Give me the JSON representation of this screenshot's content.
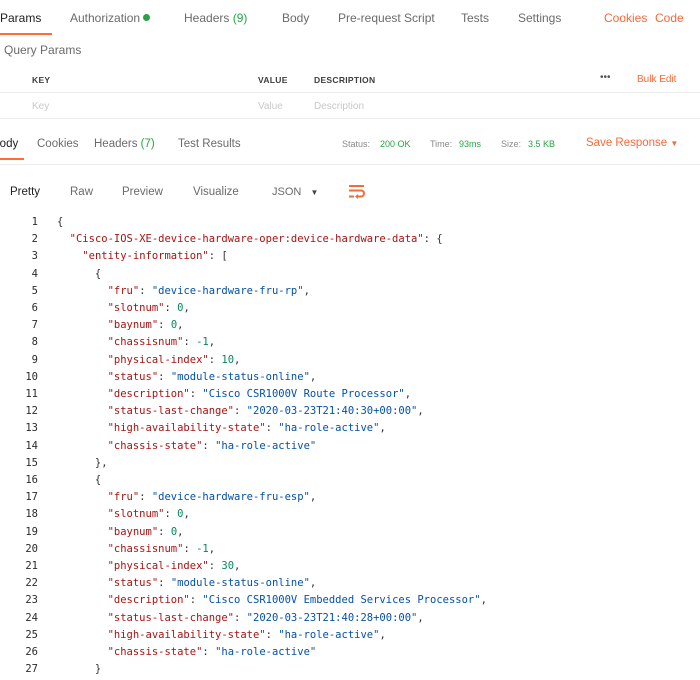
{
  "request_tabs": {
    "params": "Params",
    "authorization": "Authorization",
    "headers": "Headers",
    "headers_count": "(9)",
    "body": "Body",
    "pre_request": "Pre-request Script",
    "tests": "Tests",
    "settings": "Settings",
    "cookies": "Cookies",
    "code": "Code"
  },
  "query_params": {
    "title": "Query Params",
    "col_key": "KEY",
    "col_value": "VALUE",
    "col_description": "DESCRIPTION",
    "more": "•••",
    "bulk_edit": "Bulk Edit",
    "key_placeholder": "Key",
    "value_placeholder": "Value",
    "description_placeholder": "Description"
  },
  "response_tabs": {
    "body": "Body",
    "cookies": "Cookies",
    "headers": "Headers",
    "headers_count": "(7)",
    "test_results": "Test Results"
  },
  "response_meta": {
    "status_label": "Status:",
    "status_value": "200 OK",
    "time_label": "Time:",
    "time_value": "93ms",
    "size_label": "Size:",
    "size_value": "3.5 KB",
    "save_response": "Save Response",
    "save_arrow": "▼"
  },
  "format_toolbar": {
    "pretty": "Pretty",
    "raw": "Raw",
    "preview": "Preview",
    "visualize": "Visualize",
    "language": "JSON",
    "language_arrow": "▼"
  },
  "colors": {
    "accent": "#ff6c37",
    "green": "#27a344",
    "json_key": "#a31515",
    "json_string": "#0451a5",
    "json_number": "#098658"
  },
  "code_lines": [
    {
      "n": "1",
      "parts": [
        [
          "p",
          "{"
        ]
      ]
    },
    {
      "n": "2",
      "parts": [
        [
          "p",
          "  "
        ],
        [
          "k",
          "\"Cisco-IOS-XE-device-hardware-oper:device-hardware-data\""
        ],
        [
          "p",
          ": {"
        ]
      ]
    },
    {
      "n": "3",
      "parts": [
        [
          "p",
          "    "
        ],
        [
          "k",
          "\"entity-information\""
        ],
        [
          "p",
          ": ["
        ]
      ]
    },
    {
      "n": "4",
      "parts": [
        [
          "p",
          "      {"
        ]
      ]
    },
    {
      "n": "5",
      "parts": [
        [
          "p",
          "        "
        ],
        [
          "k",
          "\"fru\""
        ],
        [
          "p",
          ": "
        ],
        [
          "s",
          "\"device-hardware-fru-rp\""
        ],
        [
          "p",
          ","
        ]
      ]
    },
    {
      "n": "6",
      "parts": [
        [
          "p",
          "        "
        ],
        [
          "k",
          "\"slotnum\""
        ],
        [
          "p",
          ": "
        ],
        [
          "n",
          "0"
        ],
        [
          "p",
          ","
        ]
      ]
    },
    {
      "n": "7",
      "parts": [
        [
          "p",
          "        "
        ],
        [
          "k",
          "\"baynum\""
        ],
        [
          "p",
          ": "
        ],
        [
          "n",
          "0"
        ],
        [
          "p",
          ","
        ]
      ]
    },
    {
      "n": "8",
      "parts": [
        [
          "p",
          "        "
        ],
        [
          "k",
          "\"chassisnum\""
        ],
        [
          "p",
          ": "
        ],
        [
          "n",
          "-1"
        ],
        [
          "p",
          ","
        ]
      ]
    },
    {
      "n": "9",
      "parts": [
        [
          "p",
          "        "
        ],
        [
          "k",
          "\"physical-index\""
        ],
        [
          "p",
          ": "
        ],
        [
          "n",
          "10"
        ],
        [
          "p",
          ","
        ]
      ]
    },
    {
      "n": "10",
      "parts": [
        [
          "p",
          "        "
        ],
        [
          "k",
          "\"status\""
        ],
        [
          "p",
          ": "
        ],
        [
          "s",
          "\"module-status-online\""
        ],
        [
          "p",
          ","
        ]
      ]
    },
    {
      "n": "11",
      "parts": [
        [
          "p",
          "        "
        ],
        [
          "k",
          "\"description\""
        ],
        [
          "p",
          ": "
        ],
        [
          "s",
          "\"Cisco CSR1000V Route Processor\""
        ],
        [
          "p",
          ","
        ]
      ]
    },
    {
      "n": "12",
      "parts": [
        [
          "p",
          "        "
        ],
        [
          "k",
          "\"status-last-change\""
        ],
        [
          "p",
          ": "
        ],
        [
          "s",
          "\"2020-03-23T21:40:30+00:00\""
        ],
        [
          "p",
          ","
        ]
      ]
    },
    {
      "n": "13",
      "parts": [
        [
          "p",
          "        "
        ],
        [
          "k",
          "\"high-availability-state\""
        ],
        [
          "p",
          ": "
        ],
        [
          "s",
          "\"ha-role-active\""
        ],
        [
          "p",
          ","
        ]
      ]
    },
    {
      "n": "14",
      "parts": [
        [
          "p",
          "        "
        ],
        [
          "k",
          "\"chassis-state\""
        ],
        [
          "p",
          ": "
        ],
        [
          "s",
          "\"ha-role-active\""
        ]
      ]
    },
    {
      "n": "15",
      "parts": [
        [
          "p",
          "      },"
        ]
      ]
    },
    {
      "n": "16",
      "parts": [
        [
          "p",
          "      {"
        ]
      ]
    },
    {
      "n": "17",
      "parts": [
        [
          "p",
          "        "
        ],
        [
          "k",
          "\"fru\""
        ],
        [
          "p",
          ": "
        ],
        [
          "s",
          "\"device-hardware-fru-esp\""
        ],
        [
          "p",
          ","
        ]
      ]
    },
    {
      "n": "18",
      "parts": [
        [
          "p",
          "        "
        ],
        [
          "k",
          "\"slotnum\""
        ],
        [
          "p",
          ": "
        ],
        [
          "n",
          "0"
        ],
        [
          "p",
          ","
        ]
      ]
    },
    {
      "n": "19",
      "parts": [
        [
          "p",
          "        "
        ],
        [
          "k",
          "\"baynum\""
        ],
        [
          "p",
          ": "
        ],
        [
          "n",
          "0"
        ],
        [
          "p",
          ","
        ]
      ]
    },
    {
      "n": "20",
      "parts": [
        [
          "p",
          "        "
        ],
        [
          "k",
          "\"chassisnum\""
        ],
        [
          "p",
          ": "
        ],
        [
          "n",
          "-1"
        ],
        [
          "p",
          ","
        ]
      ]
    },
    {
      "n": "21",
      "parts": [
        [
          "p",
          "        "
        ],
        [
          "k",
          "\"physical-index\""
        ],
        [
          "p",
          ": "
        ],
        [
          "n",
          "30"
        ],
        [
          "p",
          ","
        ]
      ]
    },
    {
      "n": "22",
      "parts": [
        [
          "p",
          "        "
        ],
        [
          "k",
          "\"status\""
        ],
        [
          "p",
          ": "
        ],
        [
          "s",
          "\"module-status-online\""
        ],
        [
          "p",
          ","
        ]
      ]
    },
    {
      "n": "23",
      "parts": [
        [
          "p",
          "        "
        ],
        [
          "k",
          "\"description\""
        ],
        [
          "p",
          ": "
        ],
        [
          "s",
          "\"Cisco CSR1000V Embedded Services Processor\""
        ],
        [
          "p",
          ","
        ]
      ]
    },
    {
      "n": "24",
      "parts": [
        [
          "p",
          "        "
        ],
        [
          "k",
          "\"status-last-change\""
        ],
        [
          "p",
          ": "
        ],
        [
          "s",
          "\"2020-03-23T21:40:28+00:00\""
        ],
        [
          "p",
          ","
        ]
      ]
    },
    {
      "n": "25",
      "parts": [
        [
          "p",
          "        "
        ],
        [
          "k",
          "\"high-availability-state\""
        ],
        [
          "p",
          ": "
        ],
        [
          "s",
          "\"ha-role-active\""
        ],
        [
          "p",
          ","
        ]
      ]
    },
    {
      "n": "26",
      "parts": [
        [
          "p",
          "        "
        ],
        [
          "k",
          "\"chassis-state\""
        ],
        [
          "p",
          ": "
        ],
        [
          "s",
          "\"ha-role-active\""
        ]
      ]
    },
    {
      "n": "27",
      "parts": [
        [
          "p",
          "      }"
        ]
      ]
    }
  ]
}
